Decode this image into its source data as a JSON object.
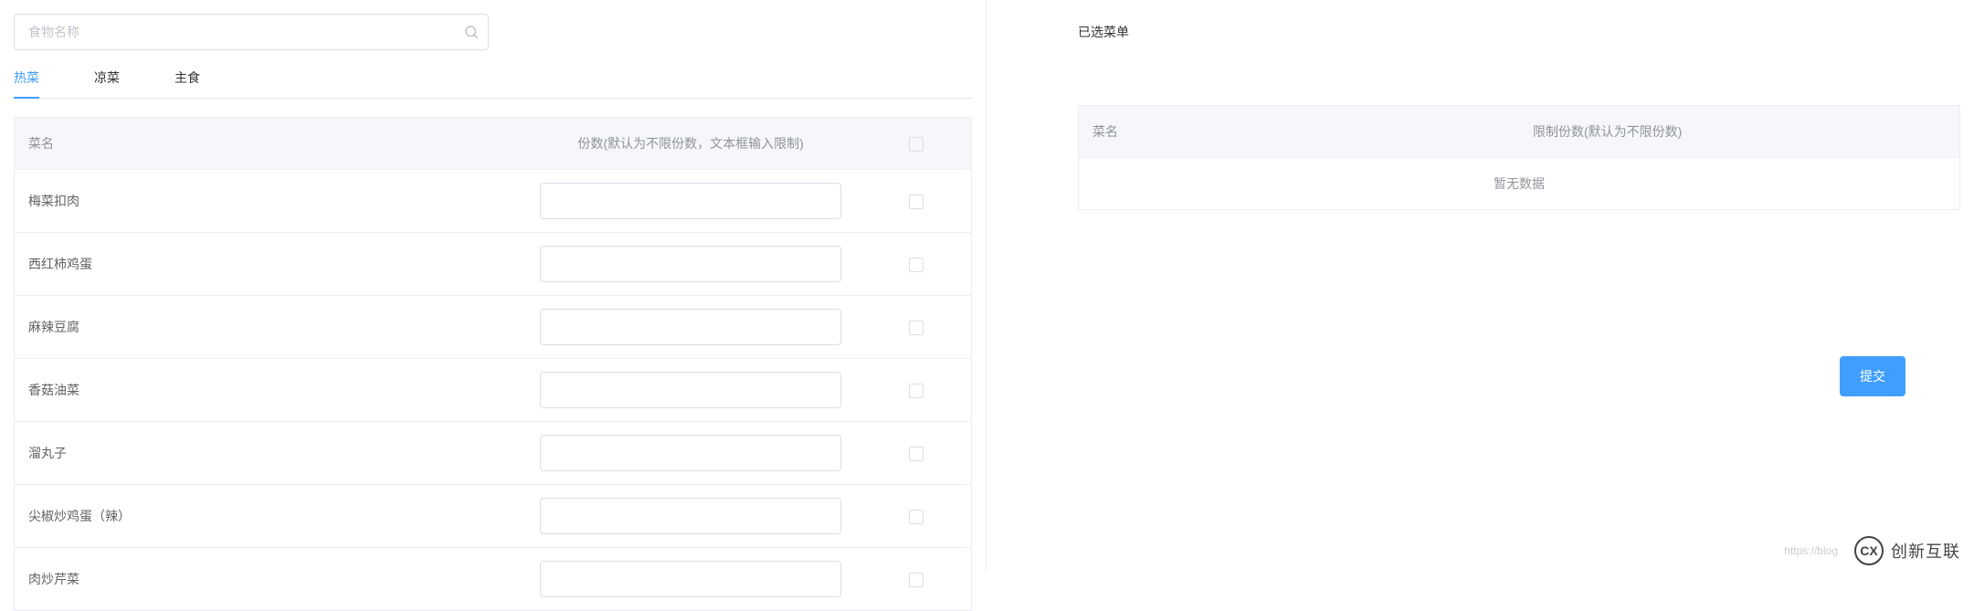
{
  "search": {
    "placeholder": "食物名称"
  },
  "tabs": [
    {
      "label": "热菜",
      "active": true
    },
    {
      "label": "凉菜",
      "active": false
    },
    {
      "label": "主食",
      "active": false
    }
  ],
  "left_table": {
    "headers": {
      "name": "菜名",
      "qty": "份数(默认为不限份数，文本框输入限制)",
      "check": ""
    },
    "rows": [
      {
        "name": "梅菜扣肉"
      },
      {
        "name": "西红柿鸡蛋"
      },
      {
        "name": "麻辣豆腐"
      },
      {
        "name": "香菇油菜"
      },
      {
        "name": "溜丸子"
      },
      {
        "name": "尖椒炒鸡蛋（辣）"
      },
      {
        "name": "肉炒芹菜"
      }
    ]
  },
  "right_panel": {
    "title": "已选菜单",
    "headers": {
      "name": "菜名",
      "limit": "限制份数(默认为不限份数)"
    },
    "empty_text": "暂无数据",
    "submit_label": "提交"
  },
  "watermark": {
    "url": "https://blog",
    "brand": "创新互联",
    "logo_text": "CX"
  }
}
